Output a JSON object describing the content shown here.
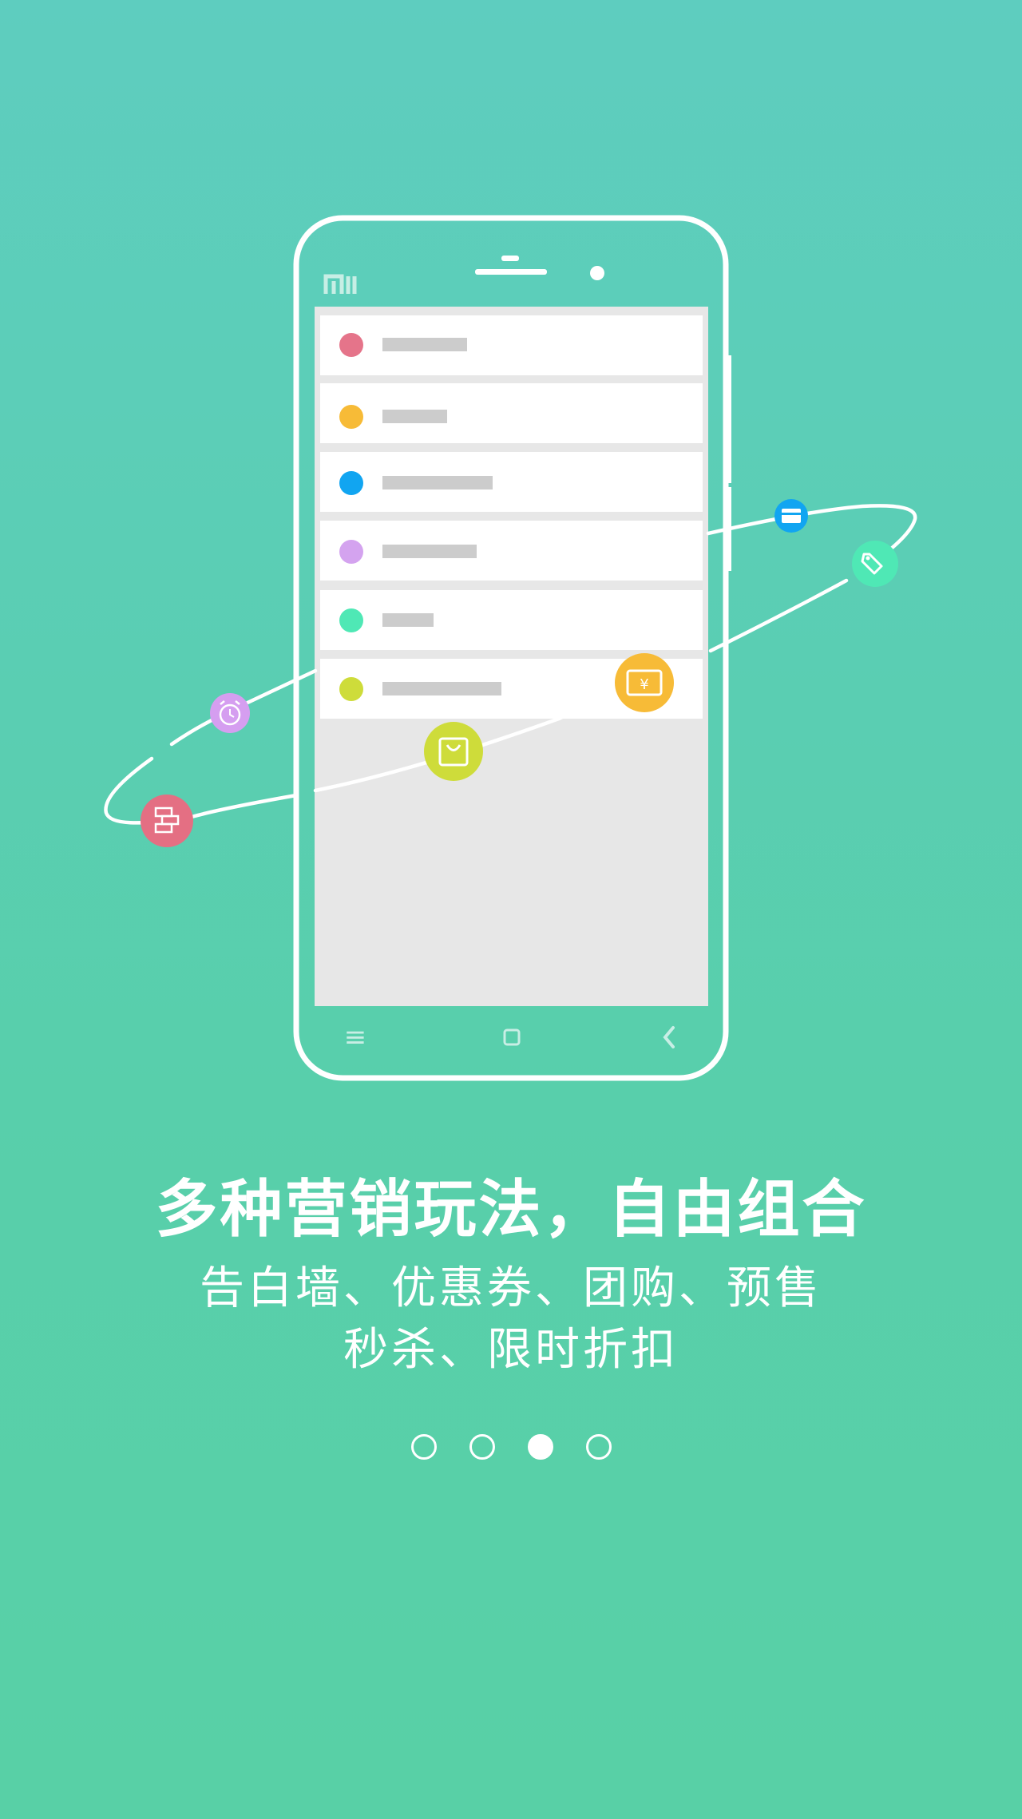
{
  "phone": {
    "brand": "mi",
    "list_items": [
      {
        "color": "#e5748a"
      },
      {
        "color": "#f7bb37"
      },
      {
        "color": "#11a5f1"
      },
      {
        "color": "#d4a3ef"
      },
      {
        "color": "#4fe8b5"
      },
      {
        "color": "#cedc3a"
      }
    ],
    "nav": {
      "menu": "≡",
      "home": "▢",
      "back": "‹"
    }
  },
  "floating_icons": [
    {
      "name": "wall-icon",
      "color": "#e46f83"
    },
    {
      "name": "alarm-clock-icon",
      "color": "#d59ef0"
    },
    {
      "name": "shopping-bag-icon",
      "color": "#cedc3a"
    },
    {
      "name": "coupon-icon",
      "color": "#f7bb37"
    },
    {
      "name": "card-icon",
      "color": "#11a5f1"
    },
    {
      "name": "tag-icon",
      "color": "#4fe8b5"
    }
  ],
  "headline": "多种营销玩法，自由组合",
  "subtitle_line1": "告白墙、优惠券、团购、预售",
  "subtitle_line2": "秒杀、限时折扣",
  "pagination": {
    "total": 4,
    "active_index": 2
  }
}
